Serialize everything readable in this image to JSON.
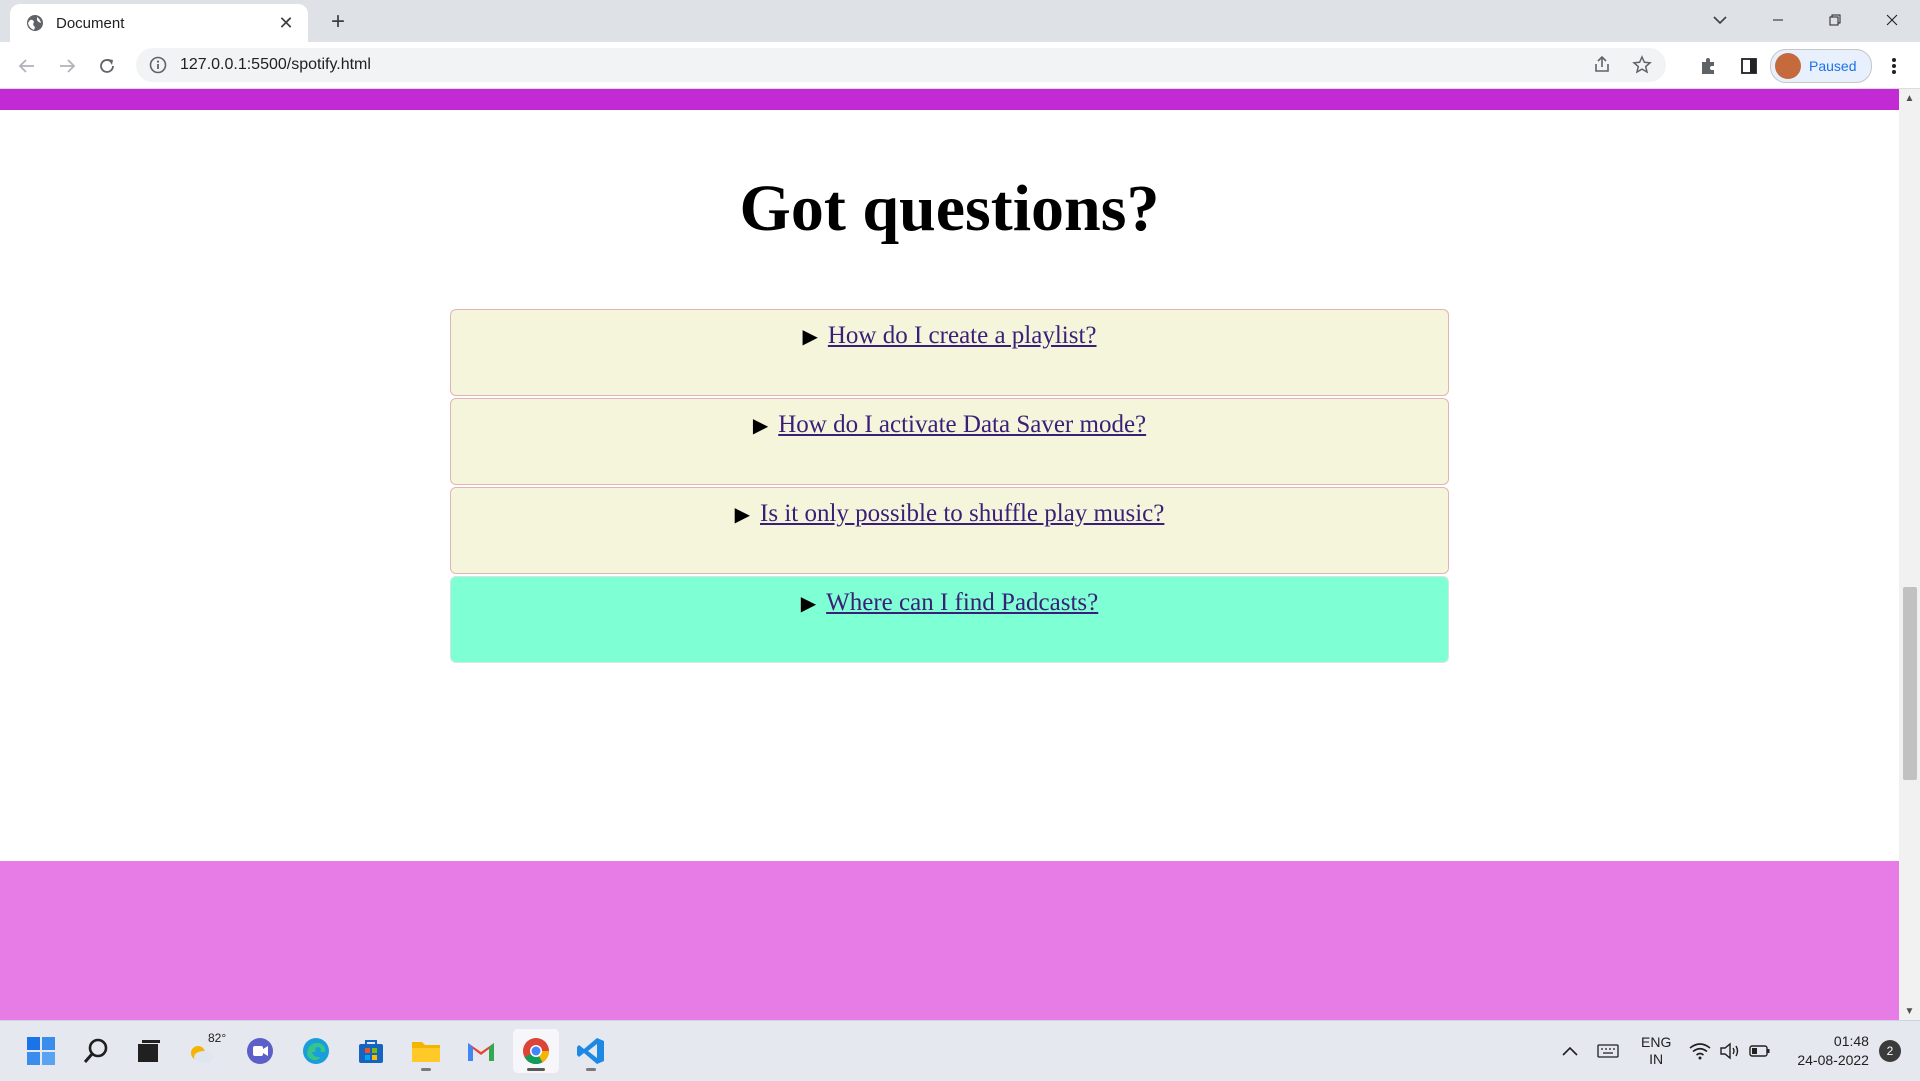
{
  "browser": {
    "tab_title": "Document",
    "tab_close": "✕",
    "new_tab": "+",
    "url": "127.0.0.1:5500/spotify.html",
    "profile_label": "Paused"
  },
  "page": {
    "heading": "Got questions?",
    "faq": [
      {
        "question": "How do I create a playlist?"
      },
      {
        "question": "How do I activate Data Saver mode?"
      },
      {
        "question": "Is it only possible to shuffle play music?"
      },
      {
        "question": "Where can I find Padcasts?"
      }
    ],
    "colors": {
      "top_bar": "#c22bd4",
      "faq_bg": "#f5f5dc",
      "faq_hover_bg": "#7fffd4",
      "footer": "#e87ce6"
    }
  },
  "taskbar": {
    "weather_temp": "82°",
    "lang_line1": "ENG",
    "lang_line2": "IN",
    "time": "01:48",
    "date": "24-08-2022",
    "notification_count": "2",
    "apps": [
      "windows-start-icon",
      "search-icon",
      "task-view-icon",
      "weather-icon",
      "teams-chat-icon",
      "edge-icon",
      "store-icon",
      "file-explorer-icon",
      "gmail-icon",
      "chrome-icon",
      "vscode-icon"
    ]
  }
}
